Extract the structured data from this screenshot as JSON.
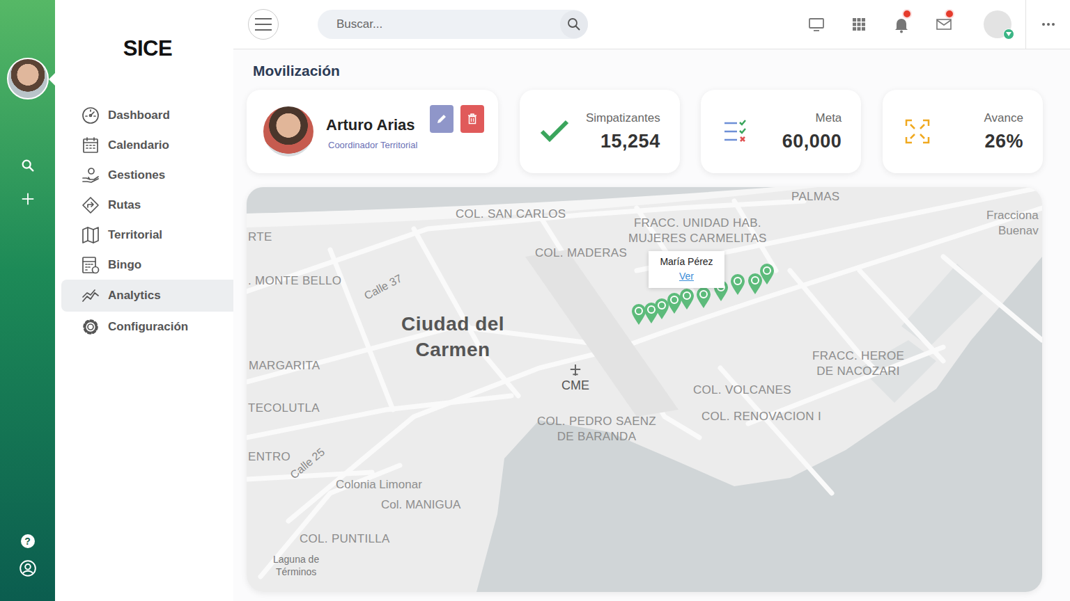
{
  "app": {
    "logo": "SICE"
  },
  "rail": {
    "help": "?"
  },
  "sidebar": {
    "items": [
      {
        "label": "Dashboard",
        "kind": "dashboard",
        "selected": false
      },
      {
        "label": "Calendario",
        "kind": "calendar",
        "selected": false
      },
      {
        "label": "Gestiones",
        "kind": "hand",
        "selected": false
      },
      {
        "label": "Rutas",
        "kind": "route",
        "selected": false
      },
      {
        "label": "Territorial",
        "kind": "map",
        "selected": false
      },
      {
        "label": "Bingo",
        "kind": "bingo",
        "selected": false
      },
      {
        "label": "Analytics",
        "kind": "analytics",
        "selected": true
      },
      {
        "label": "Configuración",
        "kind": "gear",
        "selected": false
      }
    ]
  },
  "topbar": {
    "search_placeholder": "Buscar...",
    "icons": [
      {
        "kind": "monitor",
        "badge": false
      },
      {
        "kind": "apps",
        "badge": false
      },
      {
        "kind": "bell",
        "badge": true
      },
      {
        "kind": "mail",
        "badge": true
      }
    ],
    "user": {
      "online": true
    }
  },
  "page": {
    "title": "Movilización"
  },
  "profile": {
    "name": "Arturo Arias",
    "role": "Coordinador Territorial"
  },
  "stats": [
    {
      "label": "Simpatizantes",
      "value": "15,254",
      "kind": "check"
    },
    {
      "label": "Meta",
      "value": "60,000",
      "kind": "list"
    },
    {
      "label": "Avance",
      "value": "26%",
      "kind": "progress"
    }
  ],
  "map": {
    "labels": [
      {
        "text": "PALMAS",
        "kind": "area"
      },
      {
        "text": "COL. SAN CARLOS",
        "kind": "area"
      },
      {
        "text": "FRACC. UNIDAD HAB.\nMUJERES CARMELITAS",
        "kind": "area"
      },
      {
        "text": "Fracciona\nBuenav",
        "kind": "place"
      },
      {
        "text": "RTE",
        "kind": "area"
      },
      {
        "text": "COL. MADERAS",
        "kind": "area"
      },
      {
        "text": ". MONTE BELLO",
        "kind": "area"
      },
      {
        "text": "Calle 37",
        "kind": "street"
      },
      {
        "text": "Ciudad del\nCarmen",
        "kind": "city"
      },
      {
        "text": "CME",
        "kind": "airport"
      },
      {
        "text": "MARGARITA",
        "kind": "area"
      },
      {
        "text": "TECOLUTLA",
        "kind": "area"
      },
      {
        "text": "FRACC. HEROE\nDE NACOZARI",
        "kind": "area"
      },
      {
        "text": "COL. VOLCANES",
        "kind": "area"
      },
      {
        "text": "COL. RENOVACION I",
        "kind": "area"
      },
      {
        "text": "COL. PEDRO SAENZ\nDE BARANDA",
        "kind": "area"
      },
      {
        "text": "ENTRO",
        "kind": "area"
      },
      {
        "text": "Calle 25",
        "kind": "street"
      },
      {
        "text": "Colonia Limonar",
        "kind": "place"
      },
      {
        "text": "Col. MANIGUA",
        "kind": "place"
      },
      {
        "text": "COL. PUNTILLA",
        "kind": "area"
      },
      {
        "text": "Laguna de\nTérminos",
        "kind": "water"
      }
    ],
    "pins": [
      {
        "selected": false
      },
      {
        "selected": false
      },
      {
        "selected": false
      },
      {
        "selected": false
      },
      {
        "selected": true
      },
      {
        "selected": false
      },
      {
        "selected": false
      },
      {
        "selected": false
      },
      {
        "selected": false
      },
      {
        "selected": false
      }
    ],
    "popup": {
      "name": "María Pérez",
      "link": "Ver"
    }
  }
}
